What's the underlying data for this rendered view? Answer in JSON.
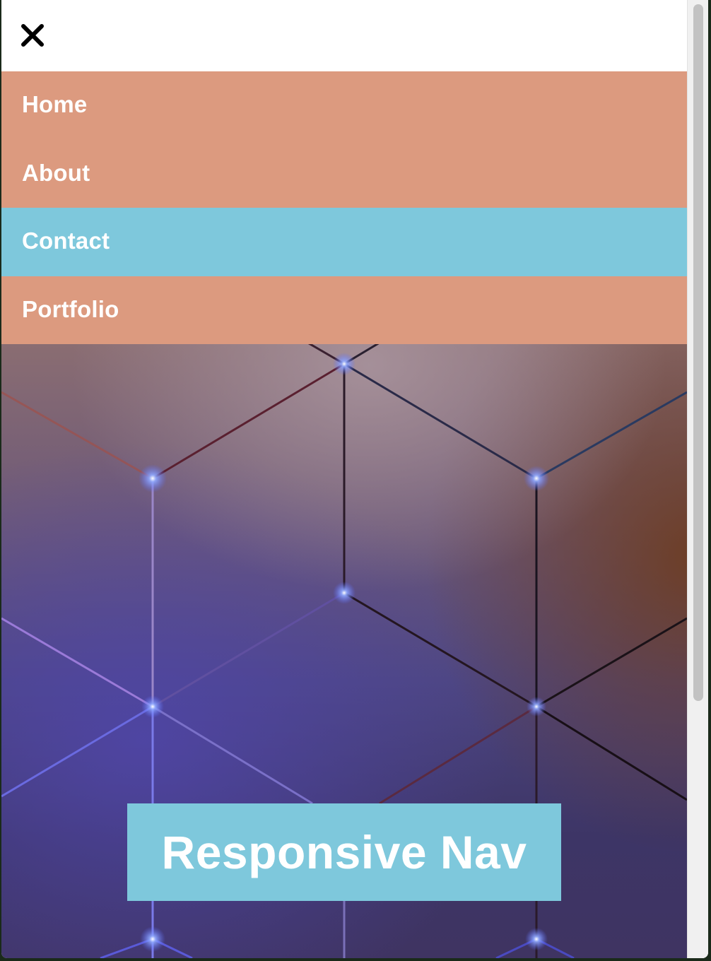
{
  "header": {
    "close_icon": "close-icon"
  },
  "nav": {
    "items": [
      {
        "label": "Home",
        "active": false
      },
      {
        "label": "About",
        "active": false
      },
      {
        "label": "Contact",
        "active": true
      },
      {
        "label": "Portfolio",
        "active": false
      }
    ]
  },
  "hero": {
    "title": "Responsive Nav",
    "background_image": "geometric-hexagon-network"
  },
  "colors": {
    "nav_item": "#dc9a7f",
    "nav_active": "#7ec8dc",
    "title_bg": "#7ec8dc",
    "text": "#ffffff"
  }
}
